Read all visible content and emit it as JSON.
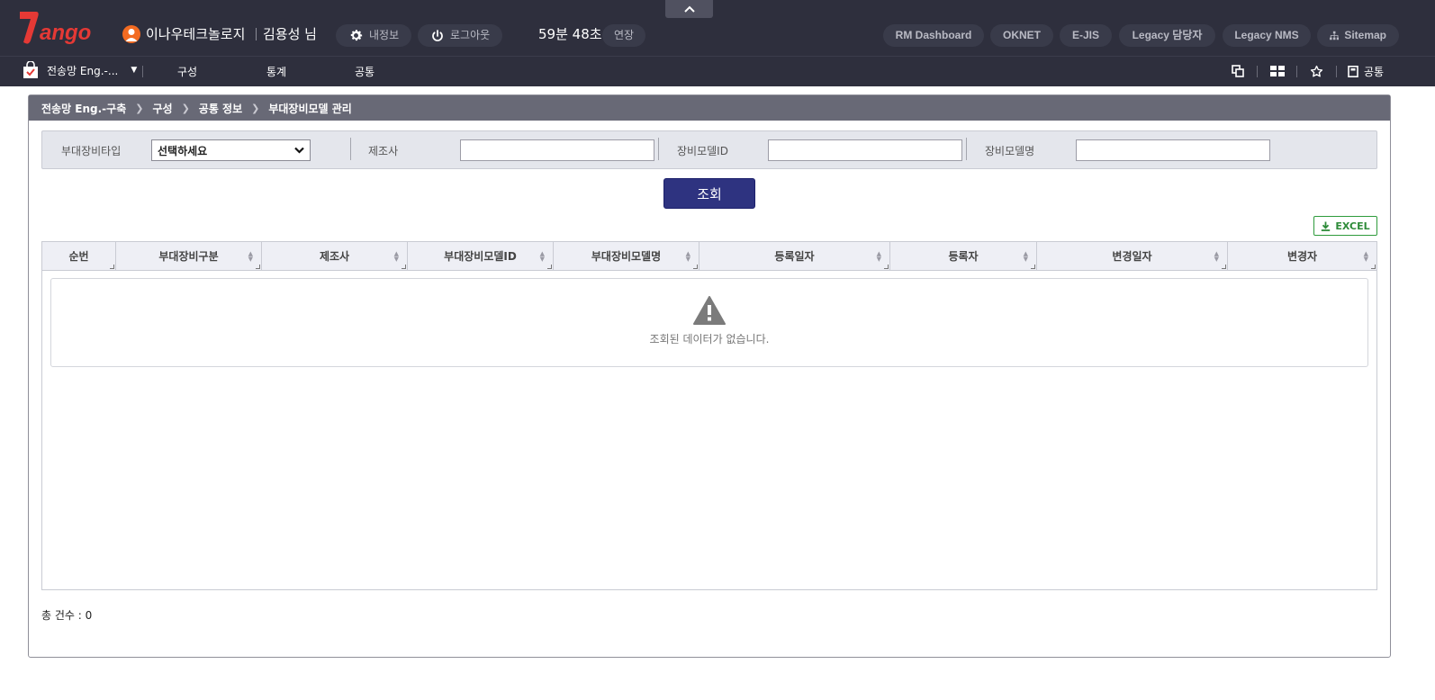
{
  "header": {
    "logo_text": "Tango",
    "company": "이나우테크놀로지",
    "user_name": "김용성 님",
    "my_info_label": "내정보",
    "logout_label": "로그아웃",
    "timer": "59분 48초",
    "extend_label": "연장",
    "links": [
      "RM Dashboard",
      "OKNET",
      "E-JIS",
      "Legacy 담당자",
      "Legacy NMS",
      "Sitemap"
    ]
  },
  "menu": {
    "selector_label": "전송망 Eng.-...",
    "items": [
      "구성",
      "통계",
      "공통"
    ],
    "common_label": "공통"
  },
  "breadcrumb": [
    "전송망 Eng.-구축",
    "구성",
    "공통 정보",
    "부대장비모델 관리"
  ],
  "search": {
    "type_label": "부대장비타입",
    "type_value": "선택하세요",
    "maker_label": "제조사",
    "maker_value": "",
    "model_id_label": "장비모델ID",
    "model_id_value": "",
    "model_name_label": "장비모델명",
    "model_name_value": "",
    "button_label": "조회"
  },
  "excel_label": "EXCEL",
  "grid": {
    "columns": [
      "순번",
      "부대장비구분",
      "제조사",
      "부대장비모델ID",
      "부대장비모델명",
      "등록일자",
      "등록자",
      "변경일자",
      "변경자"
    ],
    "empty_message": "조회된 데이터가 없습니다."
  },
  "total": "총 건수 : 0",
  "colors": {
    "topbar": "#2e2f3d",
    "accent_button": "#2e3380",
    "excel_green": "#2e8b39",
    "logo_red": "#e53935",
    "user_orange": "#f36b21"
  }
}
